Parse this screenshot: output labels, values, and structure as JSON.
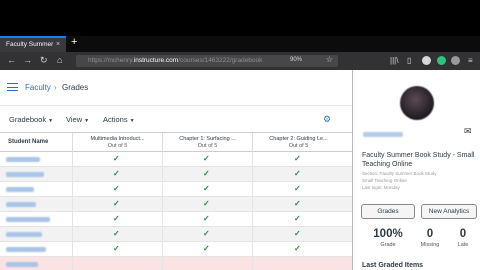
{
  "browser": {
    "tab_title": "Faculty Summer",
    "tab_close": "×",
    "new_tab": "+",
    "url_prefix": "https://",
    "url_host_pre": "mchenry.",
    "url_host": "instructure.com",
    "url_path": "/courses/1463222/gradebook",
    "zoom": "90%",
    "star": "☆"
  },
  "breadcrumb": {
    "link": "Faculty",
    "sep": "›",
    "current": "Grades"
  },
  "toolbar": {
    "gradebook": "Gradebook",
    "view": "View",
    "actions": "Actions",
    "caret": "▼"
  },
  "gradebook": {
    "student_header": "Student Name",
    "columns": [
      {
        "title": "Multimedia Introduct...",
        "sub": "Out of 5"
      },
      {
        "title": "Chapter 1: Surfacing ...",
        "sub": "Out of 5"
      },
      {
        "title": "Chapter 2: Guiding Le...",
        "sub": "Out of 5"
      }
    ],
    "check": "✓"
  },
  "panel": {
    "mail_icon": "✉",
    "course_title": "Faculty Summer Book Study - Small Teaching Online",
    "meta_lines": [
      "Section: Faculty Summer Book Study",
      "Small Teaching Online",
      "Last login: Monday"
    ],
    "grades_button": "Grades",
    "analytics_button": "New Analytics",
    "stats": [
      {
        "value": "100%",
        "label": "Grade"
      },
      {
        "value": "0",
        "label": "Missing"
      },
      {
        "value": "0",
        "label": "Late"
      }
    ],
    "last_graded": "Last Graded Items"
  },
  "colors": {
    "brand": "#2d6fb4",
    "check": "#2a8a3e",
    "chrome": "#323234"
  }
}
